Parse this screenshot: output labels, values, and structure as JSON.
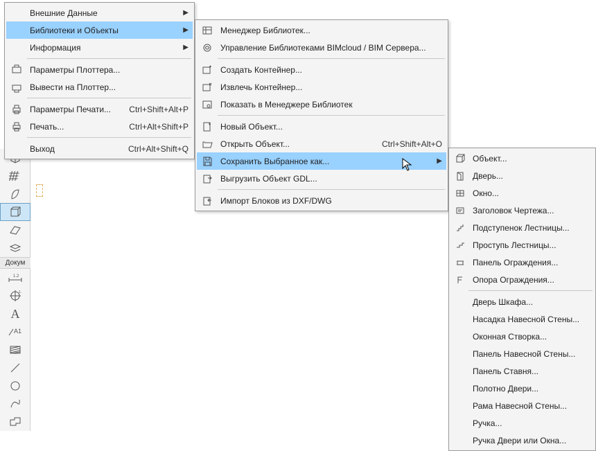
{
  "sidebar": {
    "section_label": "Докум",
    "tools_top": [
      "cube",
      "grid",
      "leaf",
      "box-sel",
      "plane",
      "layers"
    ],
    "tools_bottom": [
      "dim",
      "target",
      "text-a",
      "marker-a1",
      "hatch",
      "line",
      "circle",
      "spline",
      "shape"
    ]
  },
  "menu1": {
    "items": [
      {
        "label": "Внешние Данные",
        "submenu": true
      },
      {
        "label": "Библиотеки и Объекты",
        "submenu": true,
        "highlight": true
      },
      {
        "label": "Информация",
        "submenu": true
      },
      {
        "icon": "plotter-params",
        "label": "Параметры Плоттера..."
      },
      {
        "icon": "plot",
        "label": "Вывести на Плоттер..."
      },
      {
        "icon": "print-params",
        "label": "Параметры Печати...",
        "shortcut": "Ctrl+Shift+Alt+P"
      },
      {
        "icon": "print",
        "label": "Печать...",
        "shortcut": "Ctrl+Alt+Shift+P"
      },
      {
        "label": "Выход",
        "shortcut": "Ctrl+Alt+Shift+Q"
      }
    ]
  },
  "menu2": {
    "items": [
      {
        "icon": "lib-manager",
        "label": "Менеджер Библиотек..."
      },
      {
        "icon": "bimcloud",
        "label": "Управление Библиотеками BIMcloud / BIM Сервера..."
      },
      {
        "icon": "container-create",
        "label": "Создать Контейнер..."
      },
      {
        "icon": "container-extract",
        "label": "Извлечь Контейнер..."
      },
      {
        "icon": "lib-show",
        "label": "Показать в Менеджере Библиотек"
      },
      {
        "icon": "new-object",
        "label": "Новый Объект..."
      },
      {
        "icon": "open-object",
        "label": "Открыть Объект...",
        "shortcut": "Ctrl+Shift+Alt+O"
      },
      {
        "icon": "save-as",
        "label": "Сохранить Выбранное как...",
        "submenu": true,
        "highlight": true
      },
      {
        "icon": "export-gdl",
        "label": "Выгрузить Объект GDL..."
      },
      {
        "icon": "import-dxf",
        "label": "Импорт Блоков из DXF/DWG"
      }
    ]
  },
  "menu3": {
    "items": [
      {
        "icon": "object",
        "label": "Объект..."
      },
      {
        "icon": "door",
        "label": "Дверь..."
      },
      {
        "icon": "window",
        "label": "Окно..."
      },
      {
        "icon": "drawing-title",
        "label": "Заголовок Чертежа..."
      },
      {
        "icon": "stair-riser",
        "label": "Подступенок Лестницы..."
      },
      {
        "icon": "stair-tread",
        "label": "Проступь Лестницы..."
      },
      {
        "icon": "railing-panel",
        "label": "Панель Ограждения..."
      },
      {
        "icon": "railing-post",
        "label": "Опора Ограждения..."
      },
      {
        "label": "Дверь Шкафа..."
      },
      {
        "label": "Насадка Навесной Стены..."
      },
      {
        "label": "Оконная Створка..."
      },
      {
        "label": "Панель Навесной Стены..."
      },
      {
        "label": "Панель Ставня..."
      },
      {
        "label": "Полотно Двери..."
      },
      {
        "label": "Рама Навесной Стены..."
      },
      {
        "label": "Ручка..."
      },
      {
        "label": "Ручка Двери или Окна..."
      }
    ]
  }
}
